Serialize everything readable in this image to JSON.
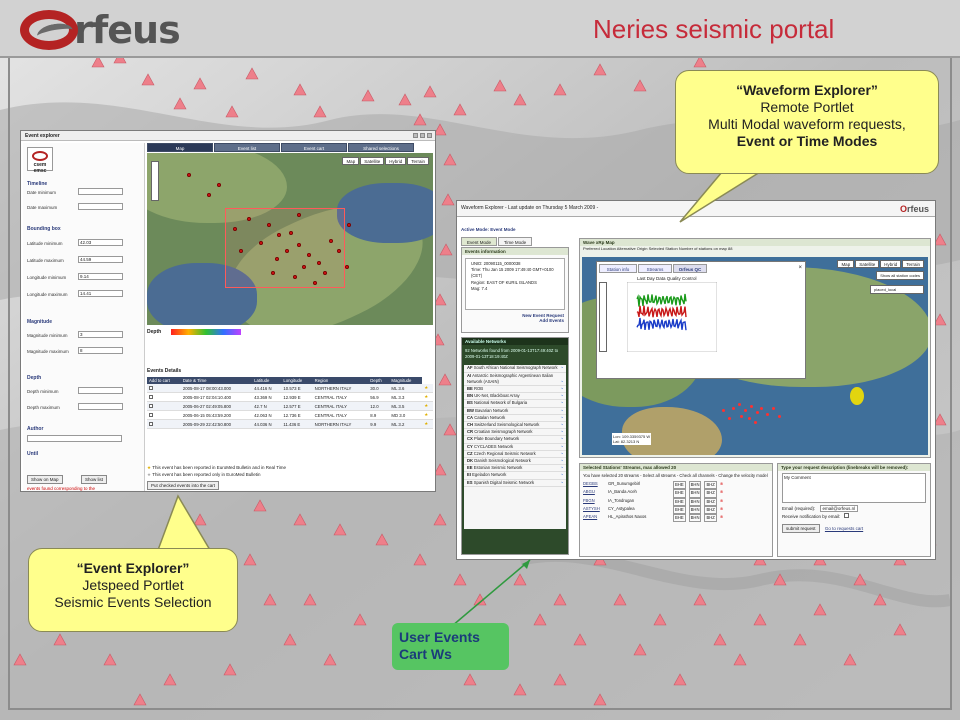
{
  "header": {
    "logo_text": "rfeus",
    "portal_title": "Neries seismic portal"
  },
  "colors": {
    "brand_red": "#b42323",
    "title_red": "#c62b3a",
    "callout_yellow": "#ffff8c",
    "badge_green": "#56c562",
    "triangle_red": "#ee7f8a"
  },
  "event_explorer": {
    "window_title": "Event explorer",
    "logo_text": "csem emsc",
    "sections": {
      "timeline": "Timeline",
      "bounding_box": "Bounding box",
      "magnitude": "Magnitude",
      "depth": "Depth",
      "author": "Author",
      "until": "Until"
    },
    "fields": {
      "date_minimum": "Date minimum",
      "date_maximum": "Date maximum",
      "latitude_minimum": "Latitude minimum",
      "latitude_minimum_value": "42.03",
      "latitude_maximum": "Latitude maximum",
      "latitude_maximum_value": "44.59",
      "longitude_minimum": "Longitude minimum",
      "longitude_minimum_value": "9.14",
      "longitude_maximum": "Longitude maximum",
      "longitude_maximum_value": "14.41",
      "magnitude_minimum": "Magnitude minimum",
      "magnitude_minimum_value": "3",
      "magnitude_maximum": "Magnitude maximum",
      "magnitude_maximum_value": "8",
      "depth_minimum": "Depth minimum",
      "depth_maximum": "Depth maximum"
    },
    "buttons": {
      "show_on_map": "Show on Map",
      "show_list": "Show list",
      "put_checked": "Put checked events into the cart"
    },
    "found_note": "events found corresponding to the",
    "tabs": [
      "Map",
      "Event list",
      "Event cart",
      "Shared selections"
    ],
    "map_buttons": [
      "Map",
      "Satellite",
      "Hybrid",
      "Terrain"
    ],
    "depth_label": "Depth",
    "events_details_label": "Events Details",
    "table": {
      "headers": [
        "Add to cart",
        "Date & Time",
        "Latitude",
        "Longitude",
        "Region",
        "Depth",
        "Magnitude"
      ],
      "subheaders": [
        "",
        "UTC",
        "degrees",
        "degrees",
        "",
        "km",
        "1"
      ],
      "rows": [
        [
          "2005-08-17 08:00:43.000",
          "44.416 N",
          "10.573 E",
          "NORTHERN ITALY",
          "30.0",
          "ML 3.6"
        ],
        [
          "2005-08-17 02:04:10.400",
          "43.369 N",
          "12.939 E",
          "CENTRAL ITALY",
          "56.9",
          "ML 3.3"
        ],
        [
          "2005-06-27 02:49:05.800",
          "42.7 N",
          "12.577 E",
          "CENTRAL ITALY",
          "12.0",
          "ML 3.5"
        ],
        [
          "2005-06-15 05:43:59.200",
          "42.063 N",
          "12.736 E",
          "CENTRAL ITALY",
          "8.9",
          "MD 3.0"
        ],
        [
          "2005-09-29 22:42:50.800",
          "44.036 N",
          "11.436 E",
          "NORTHERN ITALY",
          "9.9",
          "ML 3.2"
        ]
      ],
      "notes": [
        "This event has been reported in EuroMed Bulletin and in Real Time",
        "This event has been reported only in EuroMed Bulletin"
      ]
    }
  },
  "waveform_explorer": {
    "window_title": "Waveform Explorer - Last update on Thursday 5 March 2009 -",
    "logo_text": "Orfeus",
    "active_mode": "Active Mode: Event Mode",
    "tabs": [
      "Event Mode",
      "Time Mode"
    ],
    "events_information": "Events information",
    "event_uid": "UNID: 20090115_0000038",
    "event_time": "Time: Thu Jan 15 2009 17:49:40 GMT+0100 (CET)",
    "event_region": "Region: EAST OF KURIL ISLANDS",
    "event_mag": "Mag: 7.4",
    "new_event_request": "New Event Request",
    "add_events": "Add Events",
    "available_networks": "Available Networks",
    "networks_found": "92 Networks found from 2009-01-13T17:49:40Z to 2009-01-13T18:19:40Z",
    "networks": [
      [
        "AF",
        "South African National Seismograph Network"
      ],
      [
        "AI",
        "Antarctic Seismographic Argentinean Italian Network (ASAIN)"
      ],
      [
        "BE",
        "ROB"
      ],
      [
        "BN",
        "UK-Net, Blackboat Array"
      ],
      [
        "BS",
        "National Network of Bulgaria"
      ],
      [
        "BW",
        "Bavarian Network"
      ],
      [
        "CA",
        "Catalan Network"
      ],
      [
        "CH",
        "Switzerland Seismological Network"
      ],
      [
        "CR",
        "Croatian Seismograph Network"
      ],
      [
        "CX",
        "Plate Boundary Network"
      ],
      [
        "CY",
        "CYCLADES Network"
      ],
      [
        "CZ",
        "Czech Regional Seismic Network"
      ],
      [
        "DK",
        "Danish Seismological Network"
      ],
      [
        "EE",
        "Estonian Seismic Network"
      ],
      [
        "EI",
        "Egeladon Network"
      ],
      [
        "ES",
        "Spanish Digital Seismic Network"
      ]
    ],
    "map_title": "Wave xRp Map",
    "map_legend": "Preferred Location   Alternative Origin   Selected Station   Number of stations on map 88",
    "map_subtabs": [
      "Station info",
      "Streams",
      "Orfeus QC"
    ],
    "map_buttons": [
      "Map",
      "Satellite",
      "Hybrid",
      "Terrain"
    ],
    "show_all_station_codes": "Show all station codes",
    "station_code": "placed_local",
    "plot_title": "Last Day Data Quality Control",
    "coords": [
      "Lon: 109.3359375 W",
      "Lat: 82.3213 N"
    ],
    "streams_header": "Selected Stations' Streams, max allowed 20",
    "streams_note": "You have selected 20 streams - Select all streams - Check all channels - Change the velocity model",
    "stream_rows": [
      [
        "DEGBS",
        "GR_Sunumgebirl",
        "BHE",
        "BHN",
        "BHZ"
      ],
      [
        "ABGU",
        "IA_Banda Aceh",
        "BHE",
        "BHN",
        "BHZ"
      ],
      [
        "FBGN",
        "IA_Tondrugan",
        "BHE",
        "BHN",
        "BHZ"
      ],
      [
        "ASTYSH",
        "CY_Astypalea",
        "BHE",
        "BHN",
        "BHZ"
      ],
      [
        "APEAN",
        "HL_Apirathos Naxos",
        "BHE",
        "BHN",
        "BHZ"
      ]
    ],
    "request_header": "Type your request description (linebreaks will be removed):",
    "request_value": "My Comment",
    "email_label": "Email (required):",
    "email_value": "email@orfeus.nl",
    "notify_label": "Receive notification by email:",
    "submit_button": "submit request",
    "goto_cart": "Go to requests cart"
  },
  "callouts": {
    "waveform": {
      "title": "“Waveform Explorer”",
      "line1": "Remote Portlet",
      "line2": "Multi Modal  waveform requests,",
      "line3": "Event  or Time Modes"
    },
    "event": {
      "title": "“Event Explorer”",
      "line1": "Jetspeed Portlet",
      "line2": "Seismic Events Selection"
    },
    "cart": {
      "line1": "User Events",
      "line2": "Cart Ws"
    }
  }
}
